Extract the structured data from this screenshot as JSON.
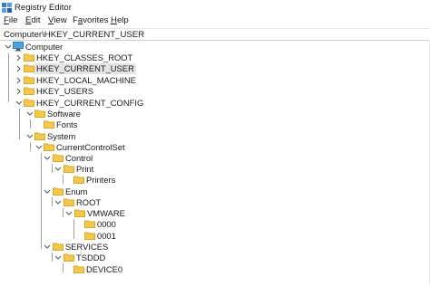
{
  "window": {
    "title": "Registry Editor"
  },
  "menu": {
    "file": {
      "u": "F",
      "rest": "ile"
    },
    "edit": {
      "u": "E",
      "rest": "dit"
    },
    "view": {
      "u": "V",
      "rest": "iew"
    },
    "favorites": {
      "u": "",
      "rest": "Favorites",
      "u2": "a"
    },
    "help": {
      "u": "H",
      "rest": "elp"
    }
  },
  "address": {
    "value": "Computer\\HKEY_CURRENT_USER"
  },
  "tree": {
    "computer": "Computer",
    "hkcr": "HKEY_CLASSES_ROOT",
    "hkcu": "HKEY_CURRENT_USER",
    "hklm": "HKEY_LOCAL_MACHINE",
    "hku": "HKEY_USERS",
    "hkcc": "HKEY_CURRENT_CONFIG",
    "software": "Software",
    "fonts": "Fonts",
    "system": "System",
    "ccs": "CurrentControlSet",
    "control": "Control",
    "print": "Print",
    "printers": "Printers",
    "enum": "Enum",
    "root": "ROOT",
    "vmware": "VMWARE",
    "k0000": "0000",
    "k0001": "0001",
    "services": "SERVICES",
    "tsddd": "TSDDD",
    "device0": "DEVICE0"
  },
  "colors": {
    "folder": "#f2c94c",
    "folder_dark": "#d9a82a",
    "selection": "#e4e4e4",
    "chevron": "#555555"
  },
  "icons": {
    "app": "registry-editor-icon",
    "computer": "computer-icon",
    "folder": "folder-icon",
    "expanded": "chevron-down-icon",
    "collapsed": "chevron-right-icon"
  }
}
